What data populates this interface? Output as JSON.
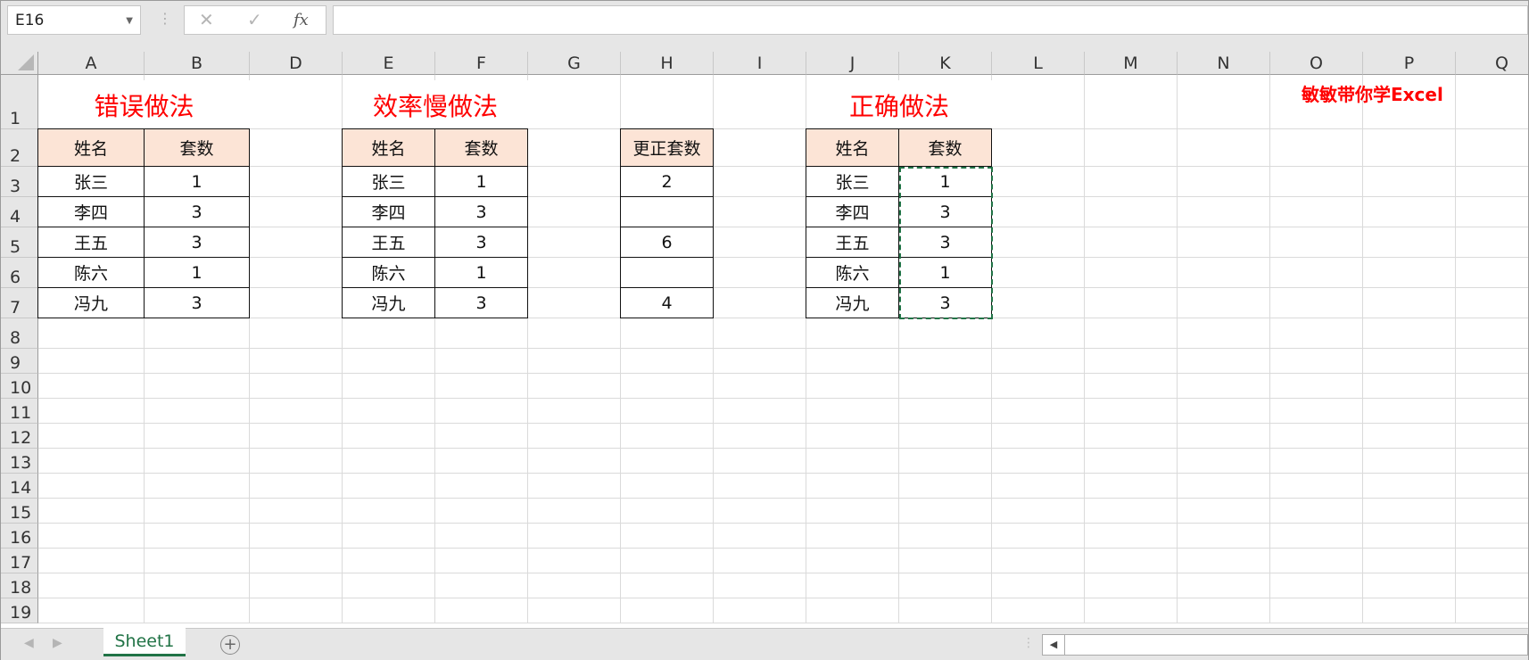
{
  "formula_bar": {
    "name_box": "E16",
    "cancel_icon": "✕",
    "enter_icon": "✓",
    "fx_label": "fx",
    "formula": ""
  },
  "columns": [
    "A",
    "B",
    "D",
    "E",
    "F",
    "G",
    "H",
    "I",
    "J",
    "K",
    "L",
    "M",
    "N",
    "O",
    "P",
    "Q"
  ],
  "rows": [
    "1",
    "2",
    "3",
    "4",
    "5",
    "6",
    "7",
    "8",
    "9",
    "10",
    "11",
    "12",
    "13",
    "14",
    "15",
    "16",
    "17",
    "18",
    "19"
  ],
  "titles": [
    {
      "text": "错误做法",
      "range": "A1:B1"
    },
    {
      "text": "效率慢做法",
      "range": "E1:F1"
    },
    {
      "text": "正确做法",
      "range": "J1:K1"
    }
  ],
  "brand": "敏敏带你学Excel",
  "tables": [
    {
      "cols": [
        "A",
        "B"
      ],
      "header": [
        "姓名",
        "套数"
      ],
      "rows": [
        [
          "张三",
          "1"
        ],
        [
          "李四",
          "3"
        ],
        [
          "王五",
          "3"
        ],
        [
          "陈六",
          "1"
        ],
        [
          "冯九",
          "3"
        ]
      ]
    },
    {
      "cols": [
        "E",
        "F"
      ],
      "header": [
        "姓名",
        "套数"
      ],
      "rows": [
        [
          "张三",
          "1"
        ],
        [
          "李四",
          "3"
        ],
        [
          "王五",
          "3"
        ],
        [
          "陈六",
          "1"
        ],
        [
          "冯九",
          "3"
        ]
      ]
    },
    {
      "cols": [
        "H"
      ],
      "header": [
        "更正套数"
      ],
      "rows": [
        [
          "2"
        ],
        [
          ""
        ],
        [
          "6"
        ],
        [
          ""
        ],
        [
          "4"
        ]
      ]
    },
    {
      "cols": [
        "J",
        "K"
      ],
      "header": [
        "姓名",
        "套数"
      ],
      "rows": [
        [
          "张三",
          "1"
        ],
        [
          "李四",
          "3"
        ],
        [
          "王五",
          "3"
        ],
        [
          "陈六",
          "1"
        ],
        [
          "冯九",
          "3"
        ]
      ]
    }
  ],
  "copy_marquee": "K3:K7",
  "sheet_tabs": [
    {
      "label": "Sheet1",
      "active": true
    }
  ],
  "add_sheet_icon": "+",
  "colors": {
    "header_fill": "#fce4d6",
    "title": "#ff0000",
    "accent": "#217346"
  }
}
